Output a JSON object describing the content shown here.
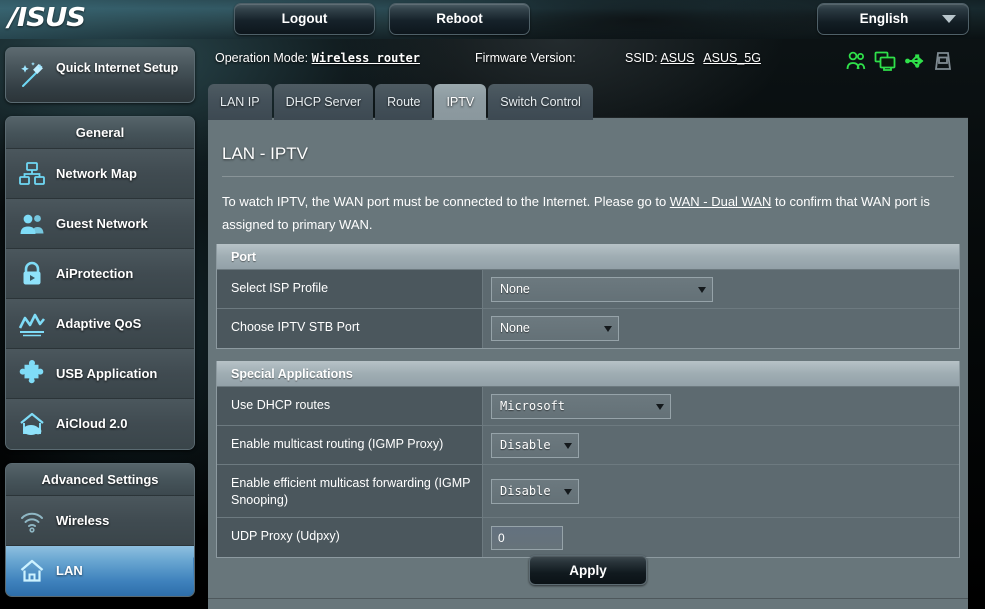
{
  "header": {
    "logo_text": "/ISUS",
    "logout_label": "Logout",
    "reboot_label": "Reboot",
    "language": "English"
  },
  "status_bar": {
    "operation_mode_label": "Operation Mode:",
    "operation_mode_value": "Wireless router",
    "firmware_label": "Firmware Version:",
    "firmware_value": "",
    "ssid_label": "SSID:",
    "ssid_1": "ASUS",
    "ssid_2": "ASUS_5G",
    "icons": [
      {
        "name": "clients-icon",
        "color": "#2fe04a"
      },
      {
        "name": "monitors-icon",
        "color": "#2fe04a"
      },
      {
        "name": "usb-icon",
        "color": "#2fe04a"
      },
      {
        "name": "printer-icon",
        "color": "#7f8b92"
      }
    ]
  },
  "sidebar": {
    "quick_internet_setup": "Quick Internet Setup",
    "general_header": "General",
    "general_items": [
      {
        "label": "Network Map",
        "icon": "network-map-icon"
      },
      {
        "label": "Guest Network",
        "icon": "guest-network-icon"
      },
      {
        "label": "AiProtection",
        "icon": "lock-icon"
      },
      {
        "label": "Adaptive QoS",
        "icon": "chart-icon"
      },
      {
        "label": "USB Application",
        "icon": "puzzle-icon"
      },
      {
        "label": "AiCloud 2.0",
        "icon": "cloud-house-icon"
      }
    ],
    "advanced_header": "Advanced Settings",
    "advanced_items": [
      {
        "label": "Wireless",
        "icon": "wifi-icon",
        "active": false
      },
      {
        "label": "LAN",
        "icon": "house-icon",
        "active": true
      }
    ]
  },
  "tabs": [
    {
      "label": "LAN IP",
      "active": false
    },
    {
      "label": "DHCP Server",
      "active": false
    },
    {
      "label": "Route",
      "active": false
    },
    {
      "label": "IPTV",
      "active": true
    },
    {
      "label": "Switch Control",
      "active": false
    }
  ],
  "main": {
    "title": "LAN - IPTV",
    "description_prefix": "To watch IPTV, the WAN port must be connected to the Internet. Please go to ",
    "description_link": "WAN - Dual WAN",
    "description_suffix": " to confirm that WAN port is assigned to primary WAN.",
    "sections": [
      {
        "header": "Port",
        "rows": [
          {
            "label": "Select ISP Profile",
            "control": "select",
            "value": "None",
            "width": "wide"
          },
          {
            "label": "Choose IPTV STB Port",
            "control": "select",
            "value": "None",
            "width": "mid"
          }
        ]
      },
      {
        "header": "Special Applications",
        "rows": [
          {
            "label": "Use DHCP routes",
            "control": "select",
            "value": "Microsoft",
            "width": "dhcp"
          },
          {
            "label": "Enable multicast routing (IGMP Proxy)",
            "control": "select",
            "value": "Disable",
            "width": "dis"
          },
          {
            "label": "Enable efficient multicast forwarding (IGMP Snooping)",
            "control": "select",
            "value": "Disable",
            "width": "dis"
          },
          {
            "label": "UDP Proxy (Udpxy)",
            "control": "text",
            "value": "0"
          }
        ]
      }
    ],
    "apply_label": "Apply"
  },
  "colors": {
    "panel_bg": "#68767b",
    "row_bg": "#4b575d",
    "control_bg": "#5d6a70",
    "section_head": "#9fadb3",
    "active_nav": "#3f82bd",
    "status_green": "#2fe04a"
  }
}
